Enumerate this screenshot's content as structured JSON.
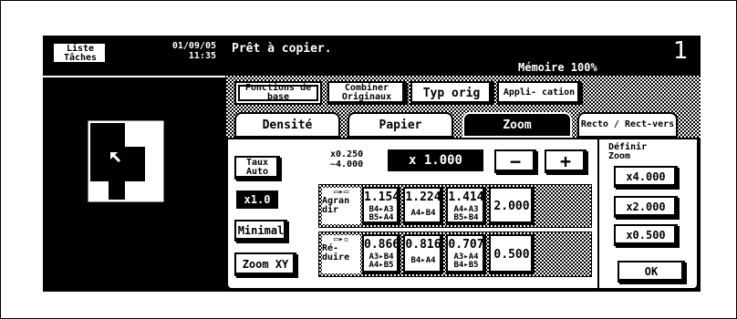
{
  "header": {
    "job_list_label": "Liste Tâches",
    "date": "01/09/05",
    "time": "11:35",
    "status": "Prêt à copier.",
    "memory": "Mémoire 100%",
    "copies": "1"
  },
  "mode_tabs": [
    {
      "label": "Fonctions de base",
      "active": true
    },
    {
      "label": "Combiner Originaux",
      "active": false
    },
    {
      "label": "Typ orig",
      "active": false
    },
    {
      "label": "Appli- cation",
      "active": false
    }
  ],
  "function_tabs": [
    {
      "label": "Densité",
      "active": false
    },
    {
      "label": "Papier",
      "active": false
    },
    {
      "label": "Zoom",
      "active": true
    },
    {
      "label": "Recto / Rect-vers",
      "active": false
    }
  ],
  "zoom": {
    "range_min": "x0.250",
    "range_max": "~4.000",
    "current": "x 1.000",
    "minus": "−",
    "plus": "+",
    "auto_label": "Taux Auto",
    "x1_label": "x1.0",
    "minimal_label": "Minimal",
    "zoom_xy_label": "Zoom XY",
    "enlarge_label": "Agran dir",
    "reduce_label": "Ré- duire",
    "enlarge": [
      {
        "value": "1.154",
        "paper": "B4▸A3 B5▸A4"
      },
      {
        "value": "1.224",
        "paper": "A4▸B4"
      },
      {
        "value": "1.414",
        "paper": "A4▸A3 B5▸B4"
      },
      {
        "value": "2.000",
        "paper": ""
      }
    ],
    "reduce": [
      {
        "value": "0.866",
        "paper": "A3▸B4 A4▸B5"
      },
      {
        "value": "0.816",
        "paper": "B4▸A4"
      },
      {
        "value": "0.707",
        "paper": "A3▸A4 B4▸B5"
      },
      {
        "value": "0.500",
        "paper": ""
      }
    ],
    "define_label": "Définir Zoom",
    "presets": [
      "x4.000",
      "x2.000",
      "x0.500"
    ],
    "ok_label": "OK"
  }
}
